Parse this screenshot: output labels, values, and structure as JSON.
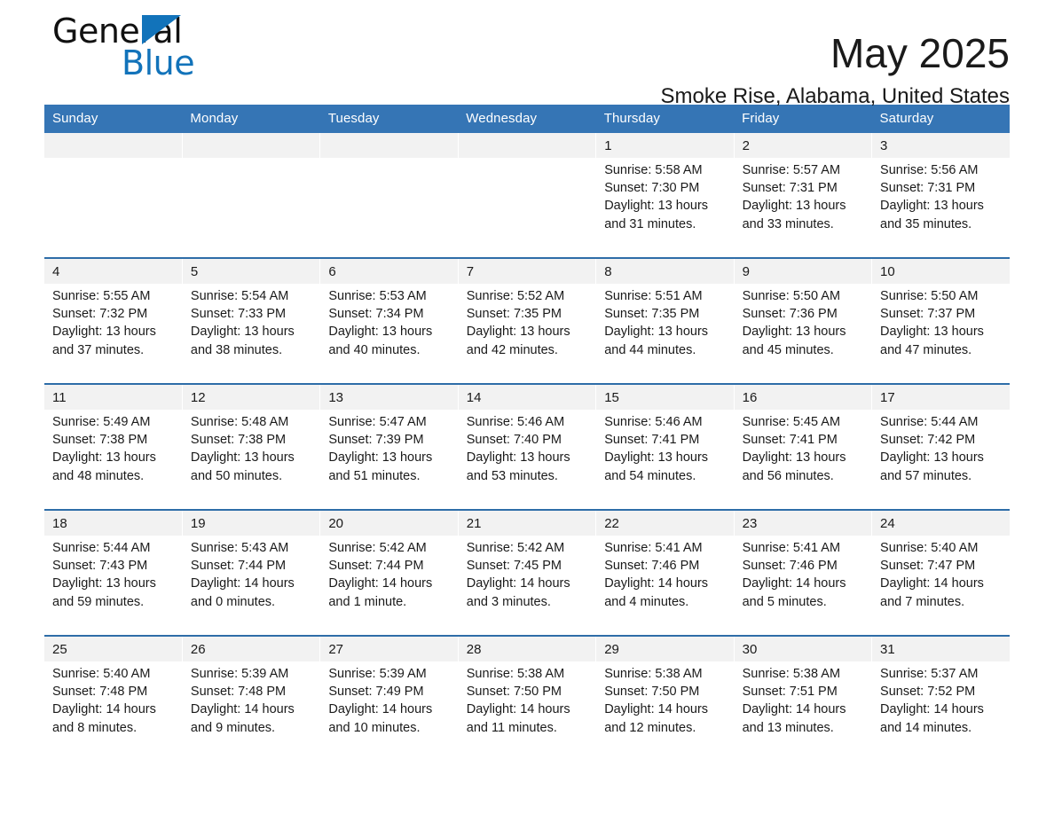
{
  "brand": {
    "line1": "General",
    "line2": "Blue",
    "triangle_color": "#1273ba"
  },
  "header": {
    "month_title": "May 2025",
    "location": "Smoke Rise, Alabama, United States"
  },
  "theme": {
    "header_blue": "#3575b5",
    "rule_blue": "#2e6da8",
    "daynum_band": "#f2f2f2",
    "text": "#1a1a1a",
    "page_background": "#ffffff"
  },
  "calendar": {
    "weekdays": [
      "Sunday",
      "Monday",
      "Tuesday",
      "Wednesday",
      "Thursday",
      "Friday",
      "Saturday"
    ],
    "labels": {
      "sunrise": "Sunrise:",
      "sunset": "Sunset:",
      "daylight": "Daylight:"
    },
    "weeks": [
      {
        "days": [
          {
            "date": "",
            "empty": true
          },
          {
            "date": "",
            "empty": true
          },
          {
            "date": "",
            "empty": true
          },
          {
            "date": "",
            "empty": true
          },
          {
            "date": "1",
            "sunrise": "Sunrise: 5:58 AM",
            "sunset": "Sunset: 7:30 PM",
            "daylight_line1": "Daylight: 13 hours",
            "daylight_line2": "and 31 minutes."
          },
          {
            "date": "2",
            "sunrise": "Sunrise: 5:57 AM",
            "sunset": "Sunset: 7:31 PM",
            "daylight_line1": "Daylight: 13 hours",
            "daylight_line2": "and 33 minutes."
          },
          {
            "date": "3",
            "sunrise": "Sunrise: 5:56 AM",
            "sunset": "Sunset: 7:31 PM",
            "daylight_line1": "Daylight: 13 hours",
            "daylight_line2": "and 35 minutes."
          }
        ]
      },
      {
        "days": [
          {
            "date": "4",
            "sunrise": "Sunrise: 5:55 AM",
            "sunset": "Sunset: 7:32 PM",
            "daylight_line1": "Daylight: 13 hours",
            "daylight_line2": "and 37 minutes."
          },
          {
            "date": "5",
            "sunrise": "Sunrise: 5:54 AM",
            "sunset": "Sunset: 7:33 PM",
            "daylight_line1": "Daylight: 13 hours",
            "daylight_line2": "and 38 minutes."
          },
          {
            "date": "6",
            "sunrise": "Sunrise: 5:53 AM",
            "sunset": "Sunset: 7:34 PM",
            "daylight_line1": "Daylight: 13 hours",
            "daylight_line2": "and 40 minutes."
          },
          {
            "date": "7",
            "sunrise": "Sunrise: 5:52 AM",
            "sunset": "Sunset: 7:35 PM",
            "daylight_line1": "Daylight: 13 hours",
            "daylight_line2": "and 42 minutes."
          },
          {
            "date": "8",
            "sunrise": "Sunrise: 5:51 AM",
            "sunset": "Sunset: 7:35 PM",
            "daylight_line1": "Daylight: 13 hours",
            "daylight_line2": "and 44 minutes."
          },
          {
            "date": "9",
            "sunrise": "Sunrise: 5:50 AM",
            "sunset": "Sunset: 7:36 PM",
            "daylight_line1": "Daylight: 13 hours",
            "daylight_line2": "and 45 minutes."
          },
          {
            "date": "10",
            "sunrise": "Sunrise: 5:50 AM",
            "sunset": "Sunset: 7:37 PM",
            "daylight_line1": "Daylight: 13 hours",
            "daylight_line2": "and 47 minutes."
          }
        ]
      },
      {
        "days": [
          {
            "date": "11",
            "sunrise": "Sunrise: 5:49 AM",
            "sunset": "Sunset: 7:38 PM",
            "daylight_line1": "Daylight: 13 hours",
            "daylight_line2": "and 48 minutes."
          },
          {
            "date": "12",
            "sunrise": "Sunrise: 5:48 AM",
            "sunset": "Sunset: 7:38 PM",
            "daylight_line1": "Daylight: 13 hours",
            "daylight_line2": "and 50 minutes."
          },
          {
            "date": "13",
            "sunrise": "Sunrise: 5:47 AM",
            "sunset": "Sunset: 7:39 PM",
            "daylight_line1": "Daylight: 13 hours",
            "daylight_line2": "and 51 minutes."
          },
          {
            "date": "14",
            "sunrise": "Sunrise: 5:46 AM",
            "sunset": "Sunset: 7:40 PM",
            "daylight_line1": "Daylight: 13 hours",
            "daylight_line2": "and 53 minutes."
          },
          {
            "date": "15",
            "sunrise": "Sunrise: 5:46 AM",
            "sunset": "Sunset: 7:41 PM",
            "daylight_line1": "Daylight: 13 hours",
            "daylight_line2": "and 54 minutes."
          },
          {
            "date": "16",
            "sunrise": "Sunrise: 5:45 AM",
            "sunset": "Sunset: 7:41 PM",
            "daylight_line1": "Daylight: 13 hours",
            "daylight_line2": "and 56 minutes."
          },
          {
            "date": "17",
            "sunrise": "Sunrise: 5:44 AM",
            "sunset": "Sunset: 7:42 PM",
            "daylight_line1": "Daylight: 13 hours",
            "daylight_line2": "and 57 minutes."
          }
        ]
      },
      {
        "days": [
          {
            "date": "18",
            "sunrise": "Sunrise: 5:44 AM",
            "sunset": "Sunset: 7:43 PM",
            "daylight_line1": "Daylight: 13 hours",
            "daylight_line2": "and 59 minutes."
          },
          {
            "date": "19",
            "sunrise": "Sunrise: 5:43 AM",
            "sunset": "Sunset: 7:44 PM",
            "daylight_line1": "Daylight: 14 hours",
            "daylight_line2": "and 0 minutes."
          },
          {
            "date": "20",
            "sunrise": "Sunrise: 5:42 AM",
            "sunset": "Sunset: 7:44 PM",
            "daylight_line1": "Daylight: 14 hours",
            "daylight_line2": "and 1 minute."
          },
          {
            "date": "21",
            "sunrise": "Sunrise: 5:42 AM",
            "sunset": "Sunset: 7:45 PM",
            "daylight_line1": "Daylight: 14 hours",
            "daylight_line2": "and 3 minutes."
          },
          {
            "date": "22",
            "sunrise": "Sunrise: 5:41 AM",
            "sunset": "Sunset: 7:46 PM",
            "daylight_line1": "Daylight: 14 hours",
            "daylight_line2": "and 4 minutes."
          },
          {
            "date": "23",
            "sunrise": "Sunrise: 5:41 AM",
            "sunset": "Sunset: 7:46 PM",
            "daylight_line1": "Daylight: 14 hours",
            "daylight_line2": "and 5 minutes."
          },
          {
            "date": "24",
            "sunrise": "Sunrise: 5:40 AM",
            "sunset": "Sunset: 7:47 PM",
            "daylight_line1": "Daylight: 14 hours",
            "daylight_line2": "and 7 minutes."
          }
        ]
      },
      {
        "days": [
          {
            "date": "25",
            "sunrise": "Sunrise: 5:40 AM",
            "sunset": "Sunset: 7:48 PM",
            "daylight_line1": "Daylight: 14 hours",
            "daylight_line2": "and 8 minutes."
          },
          {
            "date": "26",
            "sunrise": "Sunrise: 5:39 AM",
            "sunset": "Sunset: 7:48 PM",
            "daylight_line1": "Daylight: 14 hours",
            "daylight_line2": "and 9 minutes."
          },
          {
            "date": "27",
            "sunrise": "Sunrise: 5:39 AM",
            "sunset": "Sunset: 7:49 PM",
            "daylight_line1": "Daylight: 14 hours",
            "daylight_line2": "and 10 minutes."
          },
          {
            "date": "28",
            "sunrise": "Sunrise: 5:38 AM",
            "sunset": "Sunset: 7:50 PM",
            "daylight_line1": "Daylight: 14 hours",
            "daylight_line2": "and 11 minutes."
          },
          {
            "date": "29",
            "sunrise": "Sunrise: 5:38 AM",
            "sunset": "Sunset: 7:50 PM",
            "daylight_line1": "Daylight: 14 hours",
            "daylight_line2": "and 12 minutes."
          },
          {
            "date": "30",
            "sunrise": "Sunrise: 5:38 AM",
            "sunset": "Sunset: 7:51 PM",
            "daylight_line1": "Daylight: 14 hours",
            "daylight_line2": "and 13 minutes."
          },
          {
            "date": "31",
            "sunrise": "Sunrise: 5:37 AM",
            "sunset": "Sunset: 7:52 PM",
            "daylight_line1": "Daylight: 14 hours",
            "daylight_line2": "and 14 minutes."
          }
        ]
      }
    ]
  }
}
